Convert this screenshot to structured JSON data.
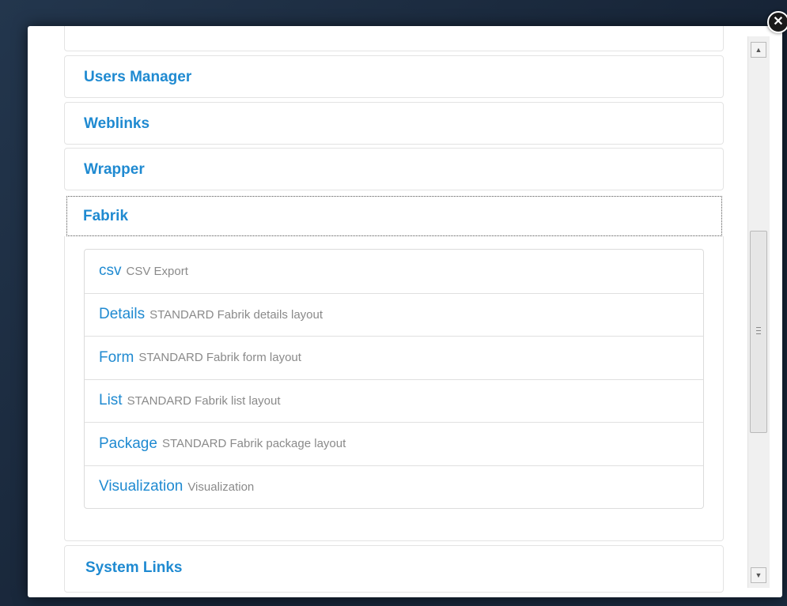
{
  "close_button": {
    "symbol": "✕"
  },
  "accordion": {
    "cut_off_label": "",
    "collapsed_before": [
      {
        "label": "Users Manager"
      },
      {
        "label": "Weblinks"
      },
      {
        "label": "Wrapper"
      }
    ],
    "active": {
      "label": "Fabrik",
      "items": [
        {
          "name": "csv",
          "description": "CSV Export"
        },
        {
          "name": "Details",
          "description": "STANDARD Fabrik details layout"
        },
        {
          "name": "Form",
          "description": "STANDARD Fabrik form layout"
        },
        {
          "name": "List",
          "description": "STANDARD Fabrik list layout"
        },
        {
          "name": "Package",
          "description": "STANDARD Fabrik package layout"
        },
        {
          "name": "Visualization",
          "description": "Visualization"
        }
      ]
    },
    "collapsed_after": [
      {
        "label": "System Links"
      }
    ]
  },
  "scrollbar": {
    "up_arrow": "▲",
    "down_arrow": "▼",
    "position_fraction": 0.55
  },
  "colors": {
    "link": "#1f8ad1",
    "description": "#8a8a8a",
    "backdrop": "#1b2a3d"
  }
}
